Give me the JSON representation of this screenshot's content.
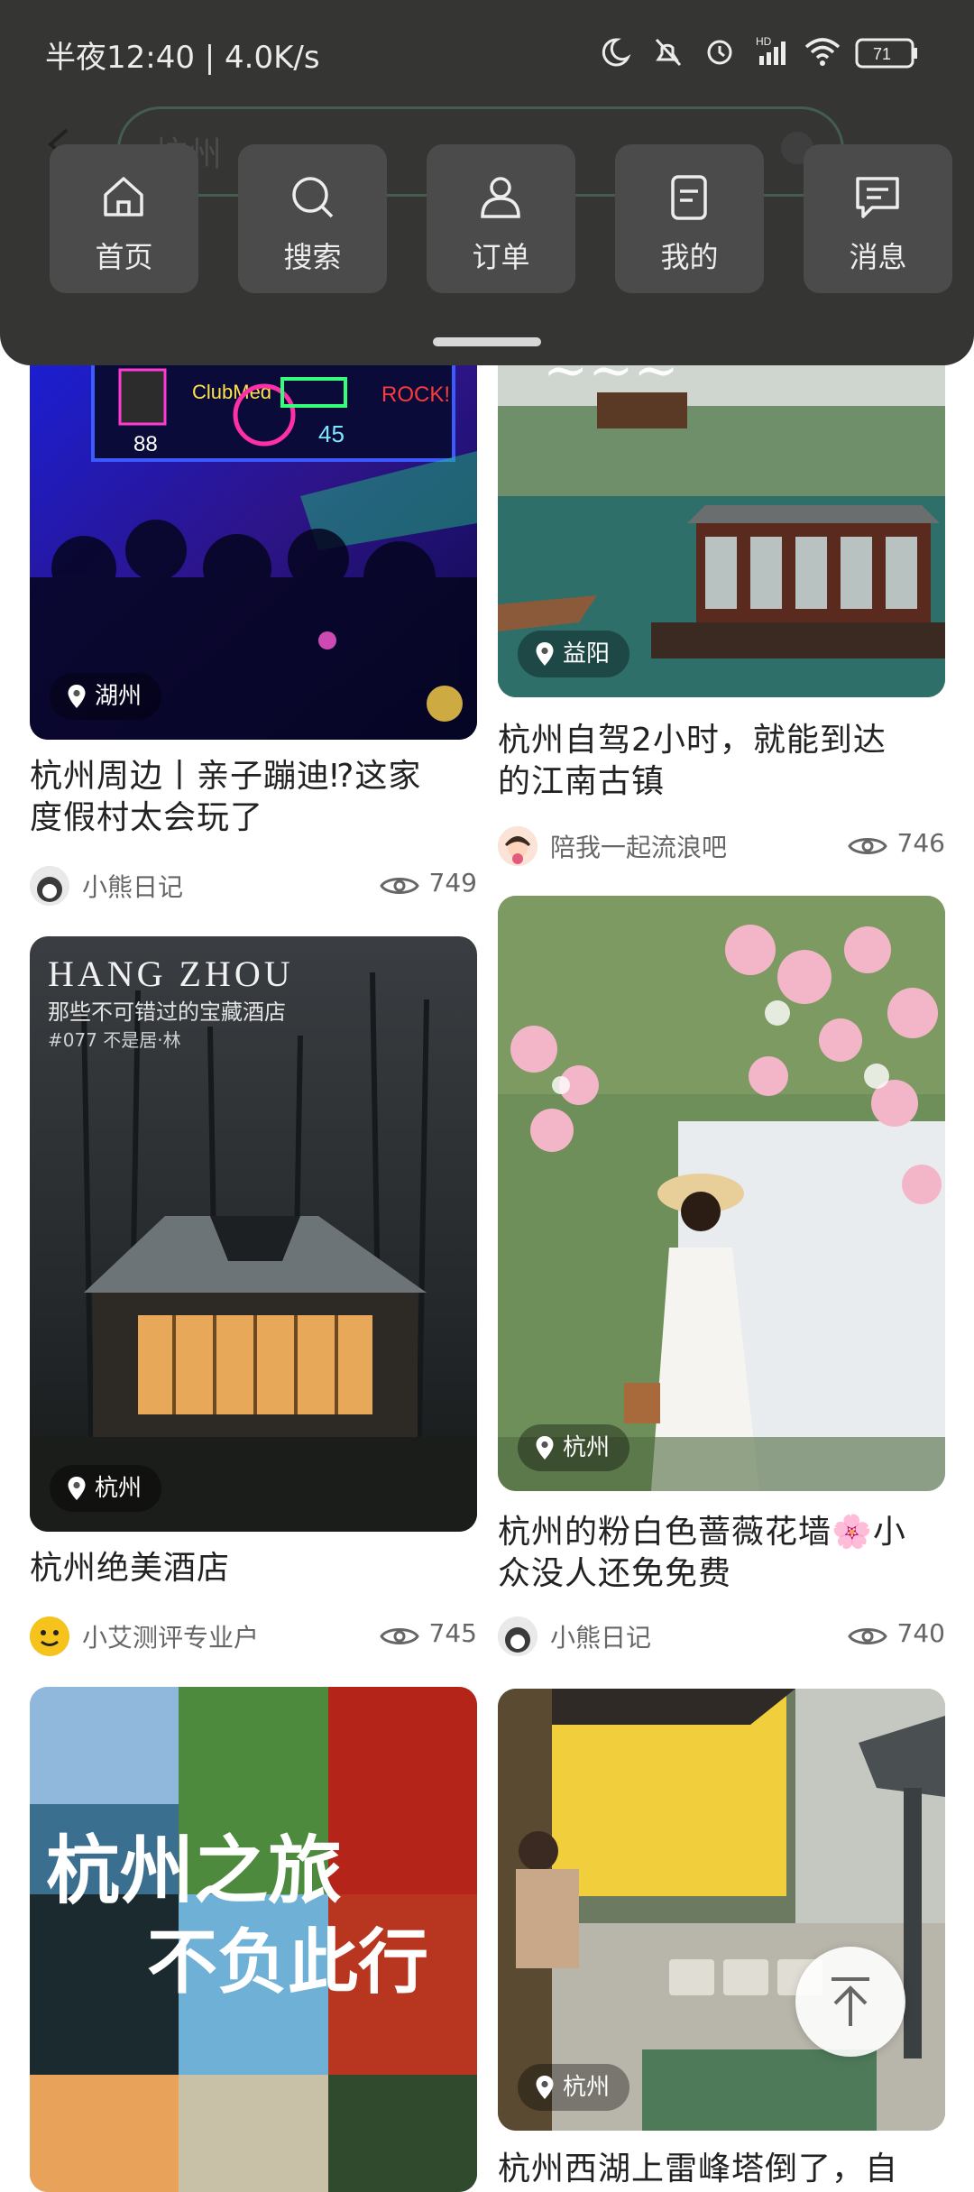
{
  "status_bar": {
    "text": "半夜12:40 | 4.0K/s",
    "battery": "71"
  },
  "search": {
    "query": "杭州"
  },
  "nav": {
    "home": "首页",
    "search": "搜索",
    "orders": "订单",
    "mine": "我的",
    "messages": "消息"
  },
  "posts": {
    "p1": {
      "location": "湖州",
      "title_line1": "杭州周边丨亲子蹦迪⁉这家",
      "title_line2": "度假村太会玩了",
      "author": "小熊日记",
      "views": "749"
    },
    "p2": {
      "location": "益阳",
      "title_line1": "杭州自驾2小时，就能到达",
      "title_line2": "的江南古镇",
      "author": "陪我一起流浪吧",
      "views": "746"
    },
    "p3": {
      "location": "杭州",
      "title": "杭州绝美酒店",
      "author": "小艾测评专业户",
      "views": "745",
      "overlay_title": "HANG ZHOU",
      "overlay_sub": "那些不可错过的宝藏酒店",
      "overlay_tag": "#077 不是居·林"
    },
    "p4": {
      "location": "杭州",
      "title_line1": "杭州的粉白色蔷薇花墙🌸小",
      "title_line2": "众没人还免免费",
      "author": "小熊日记",
      "views": "740"
    },
    "p5": {
      "overlay_line1": "杭州之旅",
      "overlay_line2": "不负此行"
    },
    "p6": {
      "location": "杭州",
      "title_partial": "杭州西湖上雷峰塔倒了，自"
    }
  },
  "colors": {
    "overlay_bg": "#353534",
    "nav_box": "#4b4b4b",
    "accent": "#1f9d6b"
  }
}
